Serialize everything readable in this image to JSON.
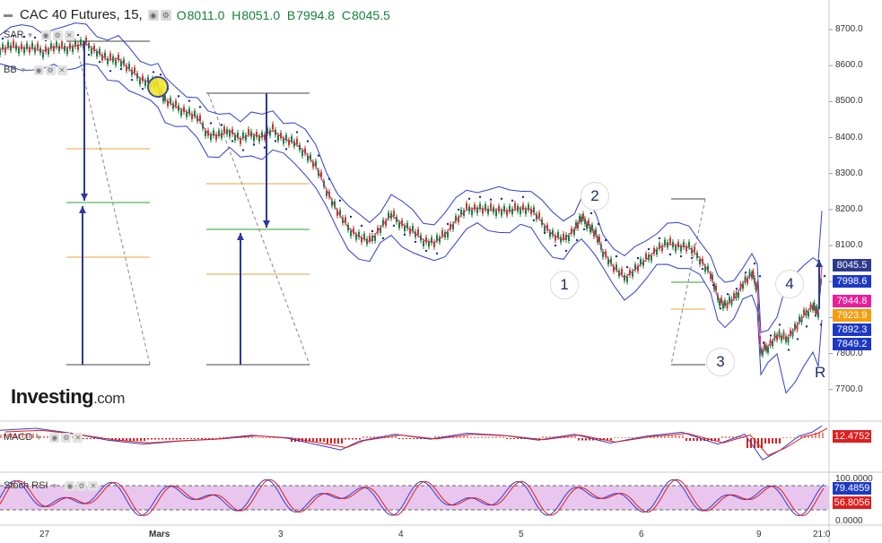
{
  "header": {
    "symbol": "CAC 40 Futures, 15,",
    "ohlc": {
      "o_label": "O",
      "o": "8011.0",
      "h_label": "H",
      "h": "8051.0",
      "l_label": "B",
      "l": "7994.8",
      "c_label": "C",
      "c": "8045.5"
    }
  },
  "indicators": {
    "sar": "SAR",
    "bb": "BB",
    "macd": "MACD",
    "stoch": "Stoch RSI"
  },
  "logo": {
    "name": "Investing",
    "suffix": ".com"
  },
  "price_axis": [
    "8700.0",
    "8600.0",
    "8500.0",
    "8400.0",
    "8300.0",
    "8200.0",
    "8100.0",
    "8000.0",
    "7900.0",
    "7800.0",
    "7700.0"
  ],
  "price_tags": [
    {
      "text": "8045.5",
      "color": "#2d3a8c"
    },
    {
      "text": "7998.6",
      "color": "#1d39c4"
    },
    {
      "text": "7944.8",
      "color": "#e91e9b"
    },
    {
      "text": "7923.9",
      "color": "#f59e0b"
    },
    {
      "text": "7892.3",
      "color": "#1d39c4"
    },
    {
      "text": "7849.2",
      "color": "#1d39c4"
    }
  ],
  "macd_axis": {
    "value": "12.4752",
    "color": "#e11d1d"
  },
  "stoch_axis": {
    "top": "100.0000",
    "zero": "0.0000",
    "k": {
      "text": "79.4859",
      "color": "#1d39c4"
    },
    "d": {
      "text": "56.8056",
      "color": "#e11d1d"
    }
  },
  "time_axis": [
    "27",
    "Mars",
    "3",
    "4",
    "5",
    "6",
    "9",
    "21:0"
  ],
  "waves": [
    "1",
    "2",
    "3",
    "4"
  ],
  "r_label": "R",
  "chart_data": {
    "type": "line",
    "title": "CAC 40 Futures, 15,",
    "ylim": [
      7660,
      8760
    ],
    "grid": false,
    "x": [
      "27",
      "Mars",
      "3",
      "4",
      "5",
      "6",
      "9"
    ],
    "series": [
      {
        "values": [
          [
            0,
            8645
          ],
          [
            12,
            8652
          ],
          [
            24,
            8650
          ],
          [
            36,
            8648
          ],
          [
            48,
            8640
          ],
          [
            60,
            8652
          ],
          [
            72,
            8648
          ],
          [
            84,
            8655
          ],
          [
            96,
            8660
          ],
          [
            108,
            8640
          ],
          [
            120,
            8615
          ],
          [
            132,
            8620
          ],
          [
            144,
            8590
          ],
          [
            156,
            8565
          ],
          [
            168,
            8552
          ],
          [
            176,
            8545
          ],
          [
            184,
            8505
          ],
          [
            196,
            8485
          ],
          [
            208,
            8472
          ],
          [
            220,
            8455
          ],
          [
            232,
            8410
          ],
          [
            244,
            8405
          ],
          [
            256,
            8420
          ],
          [
            268,
            8395
          ],
          [
            280,
            8410
          ],
          [
            292,
            8402
          ],
          [
            304,
            8420
          ],
          [
            316,
            8398
          ],
          [
            328,
            8385
          ],
          [
            340,
            8360
          ],
          [
            352,
            8320
          ],
          [
            364,
            8255
          ],
          [
            376,
            8195
          ],
          [
            388,
            8150
          ],
          [
            400,
            8125
          ],
          [
            412,
            8110
          ],
          [
            424,
            8150
          ],
          [
            436,
            8185
          ],
          [
            448,
            8160
          ],
          [
            460,
            8140
          ],
          [
            472,
            8115
          ],
          [
            484,
            8108
          ],
          [
            496,
            8130
          ],
          [
            508,
            8170
          ],
          [
            520,
            8200
          ],
          [
            532,
            8205
          ],
          [
            544,
            8198
          ],
          [
            556,
            8200
          ],
          [
            568,
            8195
          ],
          [
            580,
            8205
          ],
          [
            592,
            8200
          ],
          [
            604,
            8165
          ],
          [
            616,
            8130
          ],
          [
            628,
            8115
          ],
          [
            640,
            8145
          ],
          [
            648,
            8175
          ],
          [
            656,
            8160
          ],
          [
            664,
            8130
          ],
          [
            672,
            8085
          ],
          [
            684,
            8040
          ],
          [
            696,
            8010
          ],
          [
            708,
            8035
          ],
          [
            720,
            8060
          ],
          [
            732,
            8090
          ],
          [
            744,
            8105
          ],
          [
            756,
            8100
          ],
          [
            768,
            8095
          ],
          [
            780,
            8065
          ],
          [
            792,
            8020
          ],
          [
            800,
            7955
          ],
          [
            808,
            7935
          ],
          [
            818,
            7950
          ],
          [
            828,
            7995
          ],
          [
            838,
            8020
          ],
          [
            844,
            7985
          ],
          [
            848,
            7800
          ],
          [
            856,
            7820
          ],
          [
            866,
            7850
          ],
          [
            876,
            7840
          ],
          [
            886,
            7870
          ],
          [
            896,
            7905
          ],
          [
            906,
            7935
          ],
          [
            912,
            7910
          ],
          [
            916,
            8045
          ]
        ]
      }
    ],
    "macd": {
      "current": 12.4752,
      "values": [
        [
          0,
          8
        ],
        [
          40,
          10
        ],
        [
          80,
          5
        ],
        [
          120,
          -2
        ],
        [
          160,
          -6
        ],
        [
          200,
          -3
        ],
        [
          240,
          -1
        ],
        [
          280,
          3
        ],
        [
          320,
          0
        ],
        [
          360,
          -8
        ],
        [
          380,
          -12
        ],
        [
          400,
          -3
        ],
        [
          440,
          4
        ],
        [
          480,
          -1
        ],
        [
          520,
          5
        ],
        [
          560,
          3
        ],
        [
          600,
          -2
        ],
        [
          640,
          4
        ],
        [
          680,
          -5
        ],
        [
          720,
          2
        ],
        [
          760,
          6
        ],
        [
          800,
          -6
        ],
        [
          830,
          4
        ],
        [
          850,
          -22
        ],
        [
          870,
          -12
        ],
        [
          890,
          2
        ],
        [
          905,
          6
        ],
        [
          916,
          12.4752
        ]
      ]
    },
    "stoch_rsi": {
      "k": 79.4859,
      "d": 56.8056,
      "ylim": [
        0,
        100
      ]
    }
  }
}
